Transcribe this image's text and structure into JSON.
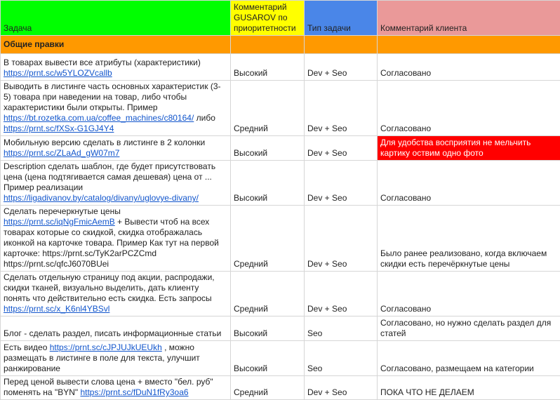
{
  "headers": {
    "task": "Задача",
    "priority": "Комментарий GUSAROV по приоритетности",
    "type": "Тип задачи",
    "client": "Комментарий клиента"
  },
  "section": "Общие правки",
  "colors": {
    "task_header": "#00ff00",
    "priority_header": "#ffff00",
    "type_header": "#4a86e8",
    "client_header": "#ea9999",
    "section": "#ff9900",
    "alert": "#ff0000",
    "link": "#1155cc"
  },
  "rows": [
    {
      "task": {
        "t1": "В товарах вывести все атрибуты (характеристики)",
        "l1": "https://prnt.sc/w5YLOZVcallb"
      },
      "priority": "Высокий",
      "type": "Dev + Seo",
      "client": "Согласовано"
    },
    {
      "task": {
        "t1": "Выводить в листинге часть основных характеристик (3-5) товара при наведении на товар, либо чтобы характеристики были открыты. Пример",
        "l1": "https://bt.rozetka.com.ua/coffee_machines/c80164/",
        "t2": " либо",
        "l2": "https://prnt.sc/fXSx-G1GJ4Y4"
      },
      "priority": "Средний",
      "type": "Dev + Seo",
      "client": "Согласовано"
    },
    {
      "task": {
        "t1": "Мобильную версию сделать в листинге в 2 колонки",
        "l1": "https://prnt.sc/ZLaAd_gW07m7"
      },
      "priority": "Высокий",
      "type": "Dev + Seo",
      "client": "Для удобства восприятия не мельчить картику оствим одно фото"
    },
    {
      "task": {
        "t1": "Description сделать шаблон, где будет присутствовать цена (цена подтягивается самая дешевая) цена от ... Пример реализации",
        "l1": "https://ligadivanov.by/catalog/divany/uglovye-divany/"
      },
      "priority": "Высокий",
      "type": "Dev + Seo",
      "client": "Согласовано"
    },
    {
      "task": {
        "t1": "Сделать перечеркнутые цены ",
        "l1": "https://prnt.sc/iqNgFmicAemB",
        "t2": " + Вывести чтоб на всех товарах которые со скидкой, скидка отображалась иконкой на карточке товара. Пример Как тут на первой карточке: https://prnt.sc/TyK2arPCZCmd https://prnt.sc/qfcJ6070BUei"
      },
      "priority": "Средний",
      "type": "Dev + Seo",
      "client": "Было ранее реализовано, когда включаем скидки есть перечёркнутые цены"
    },
    {
      "task": {
        "t1": "Сделать отдельную страницу под акции, распродажи, скидки тканей, визуально выделить, дать клиенту понять что действительно есть скидка. Есть запросы",
        "l1": "https://prnt.sc/x_K6nl4YBSvl"
      },
      "priority": "Средний",
      "type": "Dev + Seo",
      "client": "Согласовано"
    },
    {
      "task": {
        "t1": "Блог - сделать раздел, писать информационные статьи"
      },
      "priority": "Высокий",
      "type": "Seo",
      "client": "Согласовано, но нужно сделать раздел для статей"
    },
    {
      "task": {
        "t1": "Есть видео ",
        "l1": "https://prnt.sc/cJPJUJkUEUkh",
        "t2": " , можно размещать в листинге в поле для текста, улучшит ранжирование"
      },
      "priority": "Высокий",
      "type": "Seo",
      "client": "Согласовано, размещаем на категории"
    },
    {
      "task": {
        "t1": "Перед ценой вывести слова цена + вместо \"бел. руб\" поменять на \"BYN\" ",
        "l1": "https://prnt.sc/fDuN1fRy3oa6"
      },
      "priority": "Средний",
      "type": "Dev + Seo",
      "client": "ПОКА ЧТО НЕ ДЕЛАЕМ"
    }
  ]
}
